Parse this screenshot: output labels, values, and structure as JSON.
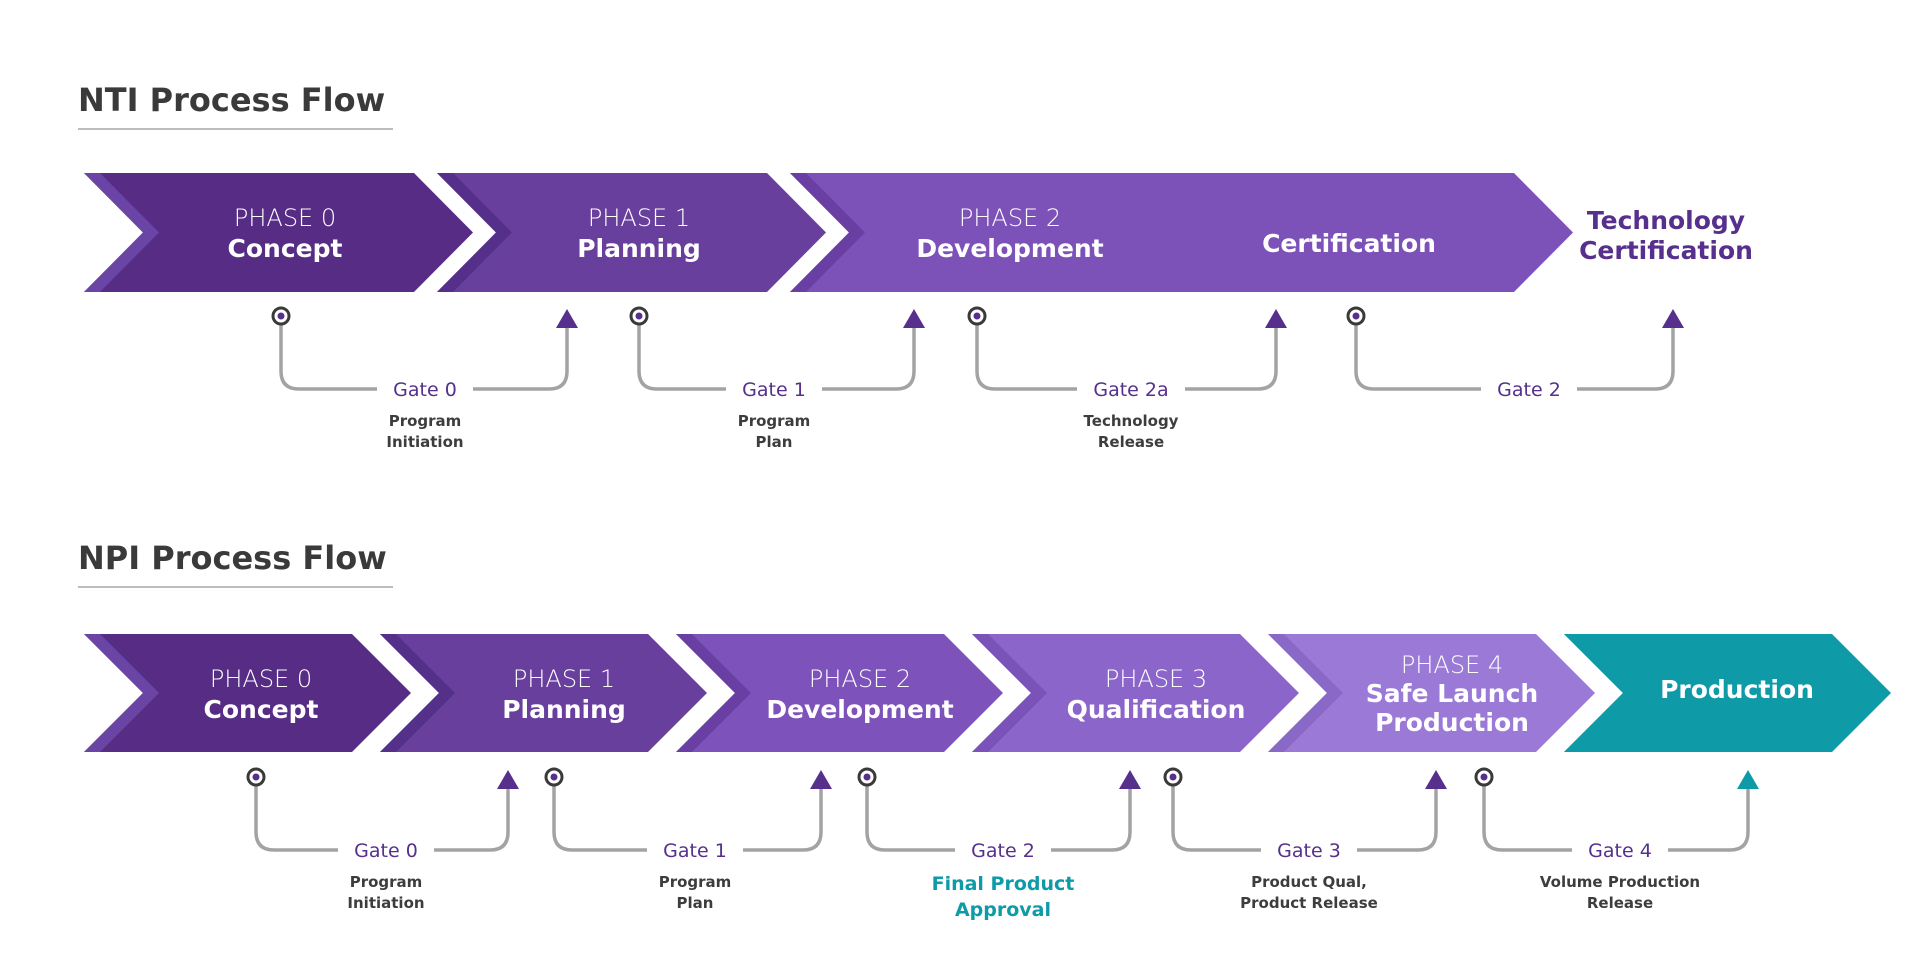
{
  "colors": {
    "title": "#3a3a3a",
    "gate_text": "#56308c",
    "connector": "#a3a3a3",
    "marker_ring": "#3a3a3a",
    "marker_dot": "#56308c",
    "teal": "#0f9aa8",
    "desc_text": "#3d3d3d"
  },
  "nti": {
    "title": "NTI Process Flow",
    "phases": [
      {
        "number": "PHASE 0",
        "name": "Concept",
        "color": "#562c85",
        "shade": "#6a45a6"
      },
      {
        "number": "PHASE 1",
        "name": "Planning",
        "color": "#693f9d",
        "shade": "#55308a"
      },
      {
        "number": "PHASE 2",
        "name": "Development",
        "extra": "Certification",
        "color": "#7c52b9",
        "shade": "#6a3fa4"
      }
    ],
    "outcome": {
      "line1": "Technology",
      "line2": "Certification",
      "color": "#56308c"
    },
    "gates": [
      {
        "label": "Gate 0",
        "desc1": "Program",
        "desc2": "Initiation"
      },
      {
        "label": "Gate 1",
        "desc1": "Program",
        "desc2": "Plan"
      },
      {
        "label": "Gate 2a",
        "desc1": "Technology",
        "desc2": "Release"
      },
      {
        "label": "Gate 2",
        "desc1": "",
        "desc2": ""
      }
    ]
  },
  "npi": {
    "title": "NPI Process Flow",
    "phases": [
      {
        "number": "PHASE 0",
        "name": "Concept",
        "name2": "",
        "color": "#562c85",
        "shade": "#6a45a6"
      },
      {
        "number": "PHASE 1",
        "name": "Planning",
        "name2": "",
        "color": "#693f9d",
        "shade": "#55308a"
      },
      {
        "number": "PHASE 2",
        "name": "Development",
        "name2": "",
        "color": "#7d52ba",
        "shade": "#6a3fa4"
      },
      {
        "number": "PHASE 3",
        "name": "Qualification",
        "name2": "",
        "color": "#8b65c9",
        "shade": "#7a52b8"
      },
      {
        "number": "PHASE 4",
        "name": "Safe Launch",
        "name2": "Production",
        "color": "#9b7ad7",
        "shade": "#8a68c8"
      },
      {
        "number": "",
        "name": "Production",
        "name2": "",
        "color": "#0f9aa8",
        "shade": "#0f9aa8"
      }
    ],
    "gates": [
      {
        "label": "Gate 0",
        "desc1": "Program",
        "desc2": "Initiation",
        "highlight": false
      },
      {
        "label": "Gate 1",
        "desc1": "Program",
        "desc2": "Plan",
        "highlight": false
      },
      {
        "label": "Gate 2",
        "desc1": "Final Product",
        "desc2": "Approval",
        "highlight": true
      },
      {
        "label": "Gate 3",
        "desc1": "Product Qual,",
        "desc2": "Product Release",
        "highlight": false
      },
      {
        "label": "Gate 4",
        "desc1": "Volume Production",
        "desc2": "Release",
        "highlight": false
      }
    ]
  }
}
